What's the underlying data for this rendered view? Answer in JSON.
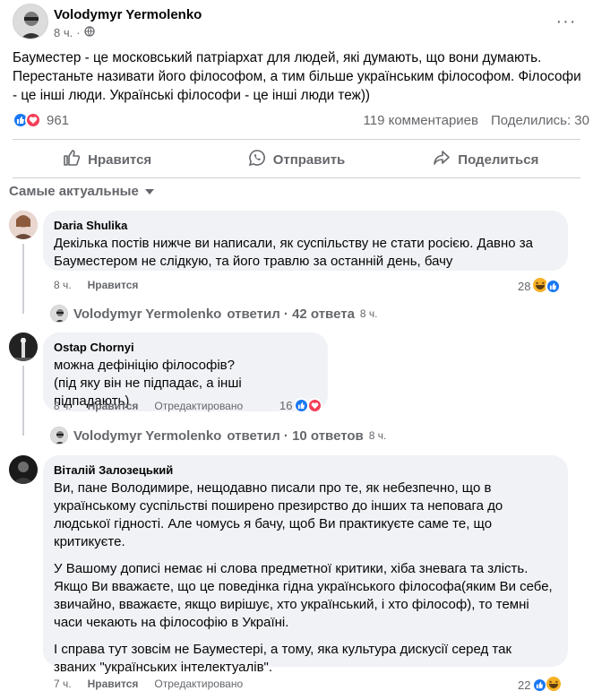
{
  "post": {
    "author": "Volodymyr Yermolenko",
    "time": "8 ч.",
    "more": "···",
    "text": "Бауместер - це московський патріархат для людей, які думають, що вони думають. Перестаньте називати його філософом, а тим більше українським філософом. Філософи - це інші люди. Українські філософи - це інші люди теж))",
    "reaction_count": "961",
    "comments_count": "119 комментариев",
    "shares_count": "Поделились: 30"
  },
  "actions": {
    "like": "Нравится",
    "send": "Отправить",
    "share": "Поделиться"
  },
  "sort_label": "Самые актуальные",
  "comments": [
    {
      "name": "Daria Shulika",
      "text": "Декілька постів нижче ви написали, як суспільству не стати росією. Давно за Бауместером не слідкую, та його травлю за останній день, бачу",
      "time": "8 ч.",
      "like": "Нравится",
      "reactions": "28",
      "replies_author": "Volodymyr Yermolenko",
      "replies_text": "ответил · 42 ответа",
      "replies_time": "8 ч."
    },
    {
      "name": "Ostap Chornyi",
      "text1": "можна дефініцію філософів?",
      "text2": "(під яку він не підпадає, а інші підпадають)",
      "time": "8 ч.",
      "like": "Нравится",
      "edited": "Отредактировано",
      "reactions": "16",
      "replies_author": "Volodymyr Yermolenko",
      "replies_text": "ответил · 10 ответов",
      "replies_time": "8 ч."
    },
    {
      "name": "Віталій Залозецький",
      "p1": "Ви, пане Володимире, нещодавно писали про те, як небезпечно, що в українському суспільстві поширено презирство до інших та неповага до людської гідності. Але чомусь я бачу, щоб Ви практикуєте саме те, що критикуєте.",
      "p2": "У Вашому дописі немає ні слова предметної критики, хіба зневага та злість. Якщо Ви вважаєте, що це поведінка гідна українського філософа(яким Ви себе, звичайно, вважаєте, якщо вирішує, хто український, і хто філософ), то темні часи чекають на філософію в Україні.",
      "p3": "І справа тут зовсім не Бауместері, а тому, яка культура дискусії серед так званих \"українських інтелектуалів\".",
      "time": "7 ч.",
      "like": "Нравится",
      "edited": "Отредактировано",
      "reactions": "22"
    }
  ],
  "colors": {
    "like_blue": "#1877f2",
    "love_red": "#f33e58",
    "haha_yellow": "#f7b125",
    "meta_gray": "#65676b",
    "bubble_bg": "#f0f2f5"
  }
}
